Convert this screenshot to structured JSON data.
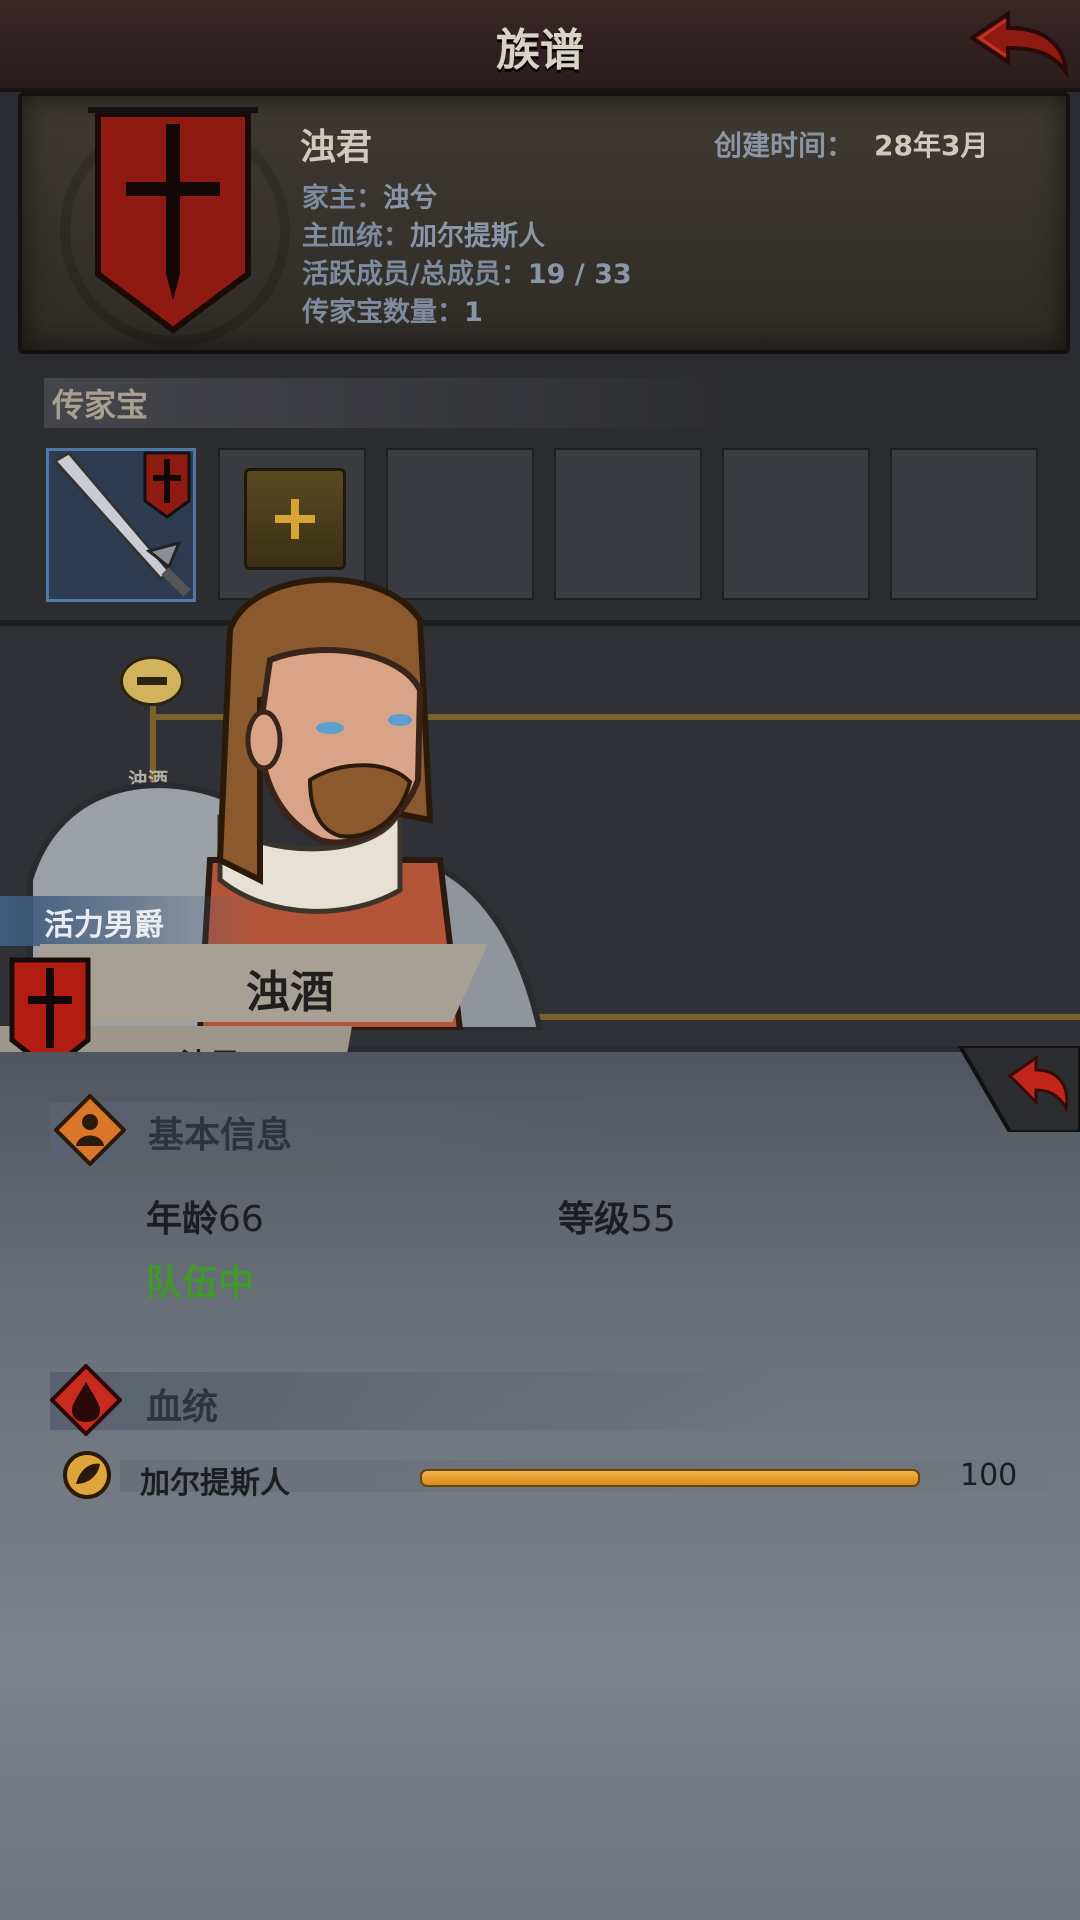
{
  "header": {
    "title": "族谱"
  },
  "family": {
    "name": "浊君",
    "created_label": "创建时间：",
    "created_value": "28年3月",
    "lines": [
      {
        "label": "家主：",
        "value": "浊兮"
      },
      {
        "label": "主血统：",
        "value": "加尔提斯人"
      },
      {
        "label": "活跃成员/总成员：",
        "value": "19 / 33"
      },
      {
        "label": "传家宝数量：",
        "value": "1"
      }
    ]
  },
  "heirloom": {
    "title": "传家宝",
    "slots_total": 6,
    "filled": 1
  },
  "tree": {
    "node_label": "浊酒"
  },
  "character": {
    "title": "活力男爵",
    "name": "浊酒",
    "family": "浊君"
  },
  "basic_info": {
    "title": "基本信息",
    "age_label": "年龄",
    "age": "66",
    "level_label": "等级",
    "level": "55",
    "status": "队伍中"
  },
  "bloodline": {
    "title": "血统",
    "items": [
      {
        "name": "加尔提斯人",
        "value": "100",
        "fraction": 1.0
      }
    ]
  },
  "colors": {
    "accent_red": "#8e1a12",
    "status_green": "#3e9a2a",
    "bar_orange": "#e6a03a"
  },
  "icons": {
    "back": "red-back-arrow-icon",
    "add": "plus-icon",
    "collapse": "minus-icon",
    "basic": "person-icon",
    "blood": "blood-drop-icon",
    "bloodline_item": "leaf-emblem-icon",
    "crest": "sword-shield-icon"
  }
}
